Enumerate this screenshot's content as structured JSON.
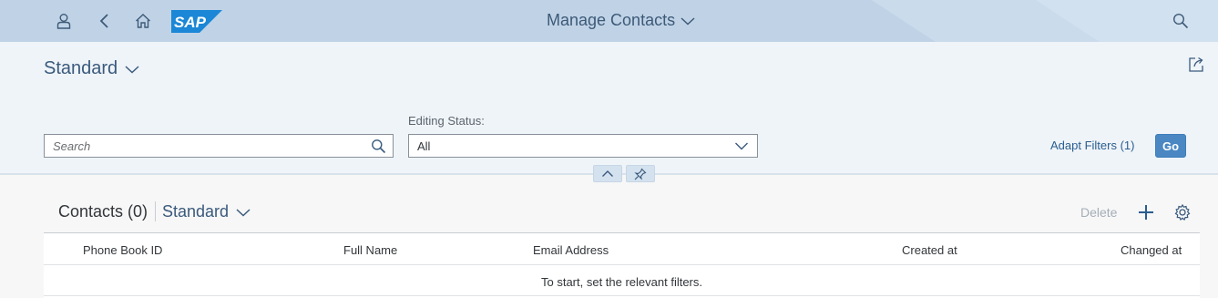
{
  "shell": {
    "title": "Manage Contacts",
    "logo_text": "SAP",
    "icons": [
      "person-icon",
      "back-icon",
      "home-icon",
      "search-icon"
    ]
  },
  "header": {
    "variant": "Standard",
    "search_placeholder": "Search",
    "editing_status_label": "Editing Status:",
    "editing_status_value": "All",
    "adapt_filters": "Adapt Filters (1)",
    "go": "Go"
  },
  "table": {
    "title": "Contacts (0)",
    "variant": "Standard",
    "delete": "Delete",
    "columns": [
      "Phone Book ID",
      "Full Name",
      "Email Address",
      "Created at",
      "Changed at"
    ],
    "empty_text": "To start, set the relevant filters."
  },
  "colors": {
    "shell_bg": "#c0d3e6",
    "header_bg": "#eff4f9",
    "accent": "#4a87c3",
    "link": "#2a5d8f",
    "logo_blue": "#1b87d6"
  }
}
